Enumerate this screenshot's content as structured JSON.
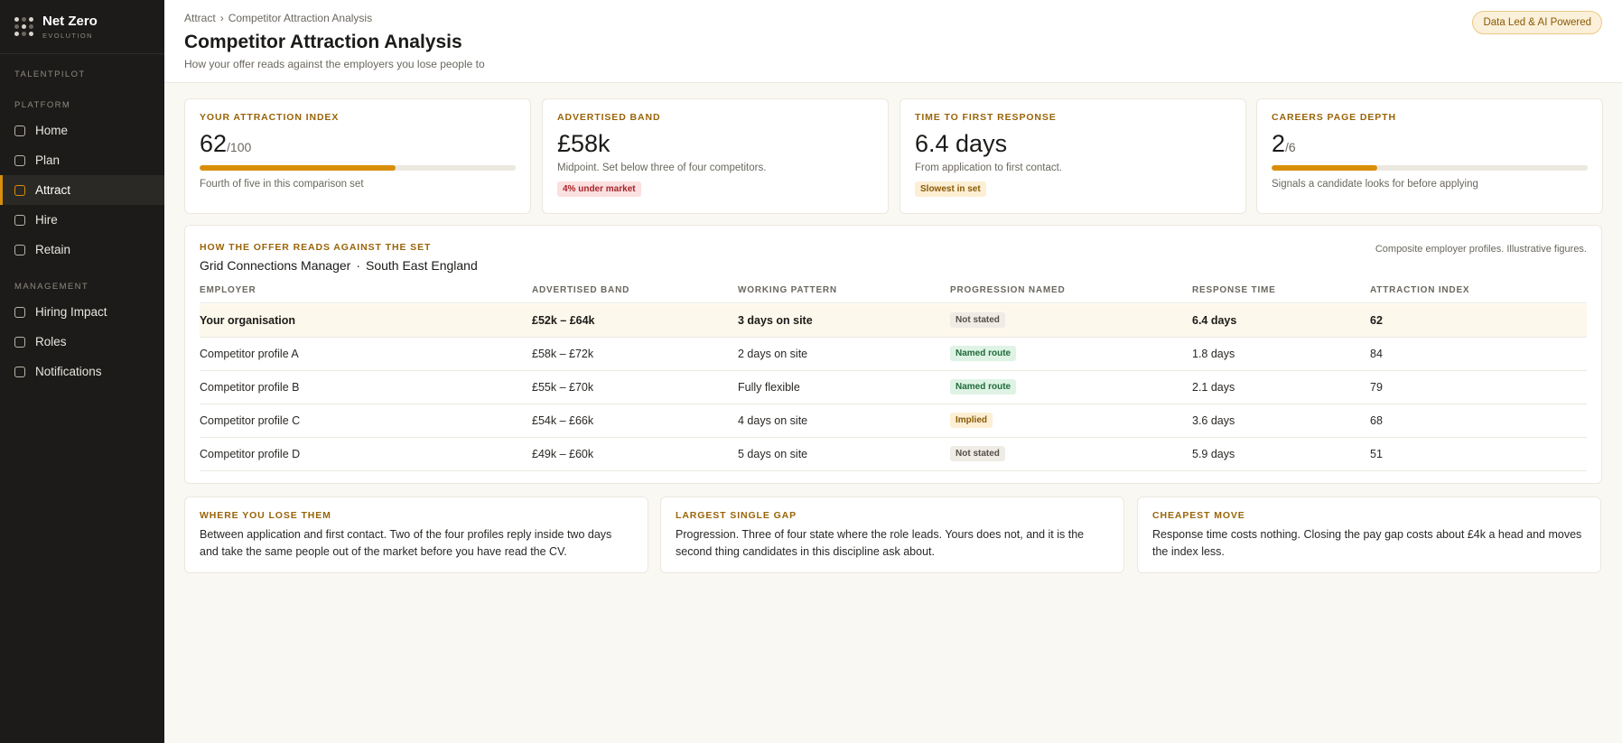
{
  "brand": {
    "name": "Net Zero",
    "sub": "EVOLUTION"
  },
  "sidebar": {
    "product": "TALENTPILOT",
    "platform_label": "PLATFORM",
    "platform_items": [
      "Home",
      "Plan",
      "Attract",
      "Hire",
      "Retain"
    ],
    "management_label": "MANAGEMENT",
    "management_items": [
      "Hiring Impact",
      "Roles",
      "Notifications"
    ],
    "active_item": "Attract"
  },
  "header": {
    "breadcrumb": [
      "Attract",
      "Competitor Attraction Analysis"
    ],
    "breadcrumb_sep": "›",
    "title": "Competitor Attraction Analysis",
    "subtitle": "How your offer reads against the employers you lose people to",
    "badge": "Data Led & AI Powered"
  },
  "kpis": [
    {
      "label": "YOUR ATTRACTION INDEX",
      "value": "62",
      "suffix": "/100",
      "progress": 0.62,
      "note": "Fourth of five in this comparison set"
    },
    {
      "label": "ADVERTISED BAND",
      "value": "£58k",
      "note": "Midpoint. Set below three of four competitors.",
      "tag": "4% under market"
    },
    {
      "label": "TIME TO FIRST RESPONSE",
      "value": "6.4 days",
      "note": "From application to first contact.",
      "tag": "Slowest in set"
    },
    {
      "label": "CAREERS PAGE DEPTH",
      "value": "2",
      "suffix": "/6",
      "progress": 0.333,
      "note": "Signals a candidate looks for before applying"
    }
  ],
  "comparison": {
    "label": "HOW THE OFFER READS AGAINST THE SET",
    "role": "Grid Connections Manager",
    "region": "South East England",
    "separator": "·",
    "note": "Composite employer profiles. Illustrative figures.",
    "columns": [
      "EMPLOYER",
      "ADVERTISED BAND",
      "WORKING PATTERN",
      "PROGRESSION NAMED",
      "RESPONSE TIME",
      "ATTRACTION INDEX"
    ],
    "rows": [
      {
        "employer": "Your organisation",
        "band": "£52k – £64k",
        "pattern": "3 days on site",
        "progression": "Not stated",
        "response": "6.4 days",
        "index": "62"
      },
      {
        "employer": "Competitor profile A",
        "band": "£58k – £72k",
        "pattern": "2 days on site",
        "progression": "Named route",
        "response": "1.8 days",
        "index": "84"
      },
      {
        "employer": "Competitor profile B",
        "band": "£55k – £70k",
        "pattern": "Fully flexible",
        "progression": "Named route",
        "response": "2.1 days",
        "index": "79"
      },
      {
        "employer": "Competitor profile C",
        "band": "£54k – £66k",
        "pattern": "4 days on site",
        "progression": "Implied",
        "response": "3.6 days",
        "index": "68"
      },
      {
        "employer": "Competitor profile D",
        "band": "£49k – £60k",
        "pattern": "5 days on site",
        "progression": "Not stated",
        "response": "5.9 days",
        "index": "51"
      }
    ]
  },
  "insights": [
    {
      "label": "WHERE YOU LOSE THEM",
      "body": "Between application and first contact. Two of the four profiles reply inside two days and take the same people out of the market before you have read the CV."
    },
    {
      "label": "LARGEST SINGLE GAP",
      "body": "Progression. Three of four state where the role leads. Yours does not, and it is the second thing candidates in this discipline ask about."
    },
    {
      "label": "CHEAPEST MOVE",
      "body": "Response time costs nothing. Closing the pay gap costs about £4k a head and moves the index less."
    }
  ],
  "colors": {
    "accent": "#d98e0a",
    "sidebar": "#1c1b19",
    "background": "#faf8f3"
  }
}
